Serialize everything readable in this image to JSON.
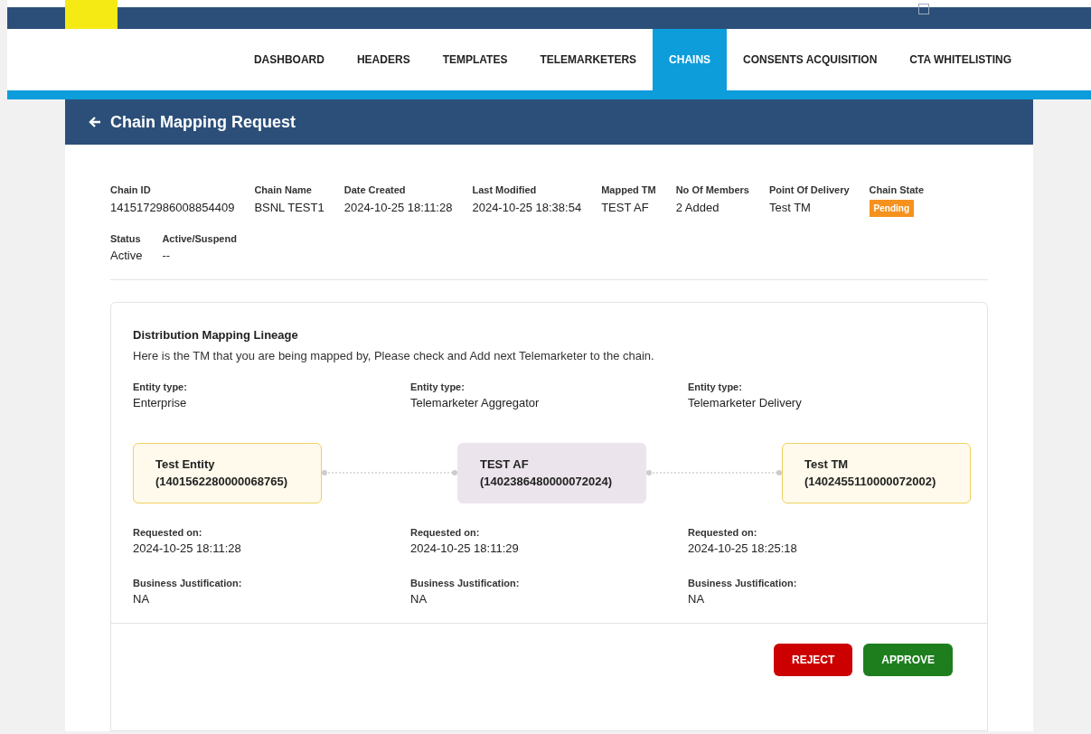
{
  "nav": {
    "tabs": [
      {
        "label": "DASHBOARD",
        "selected": false
      },
      {
        "label": "HEADERS",
        "selected": false
      },
      {
        "label": "TEMPLATES",
        "selected": false
      },
      {
        "label": "TELEMARKETERS",
        "selected": false
      },
      {
        "label": "CHAINS",
        "selected": true
      },
      {
        "label": "CONSENTS ACQUISITION",
        "selected": false
      },
      {
        "label": "CTA WHITELISTING",
        "selected": false
      }
    ]
  },
  "page": {
    "title": "Chain Mapping Request"
  },
  "details": [
    [
      {
        "label": "Chain ID",
        "value": "1415172986008854409",
        "kind": "text"
      },
      {
        "label": "Chain Name",
        "value": "BSNL TEST1",
        "kind": "text"
      },
      {
        "label": "Date Created",
        "value": "2024-10-25 18:11:28",
        "kind": "text"
      },
      {
        "label": "Last Modified",
        "value": "2024-10-25 18:38:54",
        "kind": "text"
      },
      {
        "label": "Mapped TM",
        "value": "TEST AF",
        "kind": "text"
      },
      {
        "label": "No Of Members",
        "value": "2 Added",
        "kind": "text"
      },
      {
        "label": "Point Of Delivery",
        "value": "Test TM",
        "kind": "text"
      },
      {
        "label": "Chain State",
        "value": "Pending",
        "kind": "badge"
      }
    ],
    [
      {
        "label": "Status",
        "value": "Active",
        "kind": "text"
      },
      {
        "label": "Active/Suspend",
        "value": "--",
        "kind": "text"
      }
    ]
  ],
  "lineage": {
    "title": "Distribution Mapping Lineage",
    "description": "Here is the TM that you are being mapped by, Please check and Add next Telemarketer to the chain.",
    "entity_type_label": [
      "Entity type:",
      "Entity type:",
      "Entity type:"
    ],
    "members": [
      {
        "entity_type": "Enterprise",
        "name": "Test Entity",
        "id": "(1401562280000068765)",
        "kind": "member",
        "requested_label": "Requested on:",
        "requested_on": "2024-10-25 18:11:28",
        "justification_label": "Business Justification:",
        "justification": "NA"
      },
      {
        "entity_type": "Telemarketer Aggregator",
        "name": "TEST AF",
        "id": "(1402386480000072024)",
        "kind": "current",
        "requested_label": "Requested on:",
        "requested_on": "2024-10-25 18:11:29",
        "justification_label": "Business Justification:",
        "justification": "NA"
      },
      {
        "entity_type": "Telemarketer Delivery",
        "name": "Test TM",
        "id": "(1402455110000072002)",
        "kind": "member",
        "requested_label": "Requested on:",
        "requested_on": "2024-10-25 18:25:18",
        "justification_label": "Business Justification:",
        "justification": "NA"
      }
    ]
  },
  "actions": [
    {
      "label": "REJECT",
      "kind": "reject"
    },
    {
      "label": "APPROVE",
      "kind": "approve"
    }
  ]
}
